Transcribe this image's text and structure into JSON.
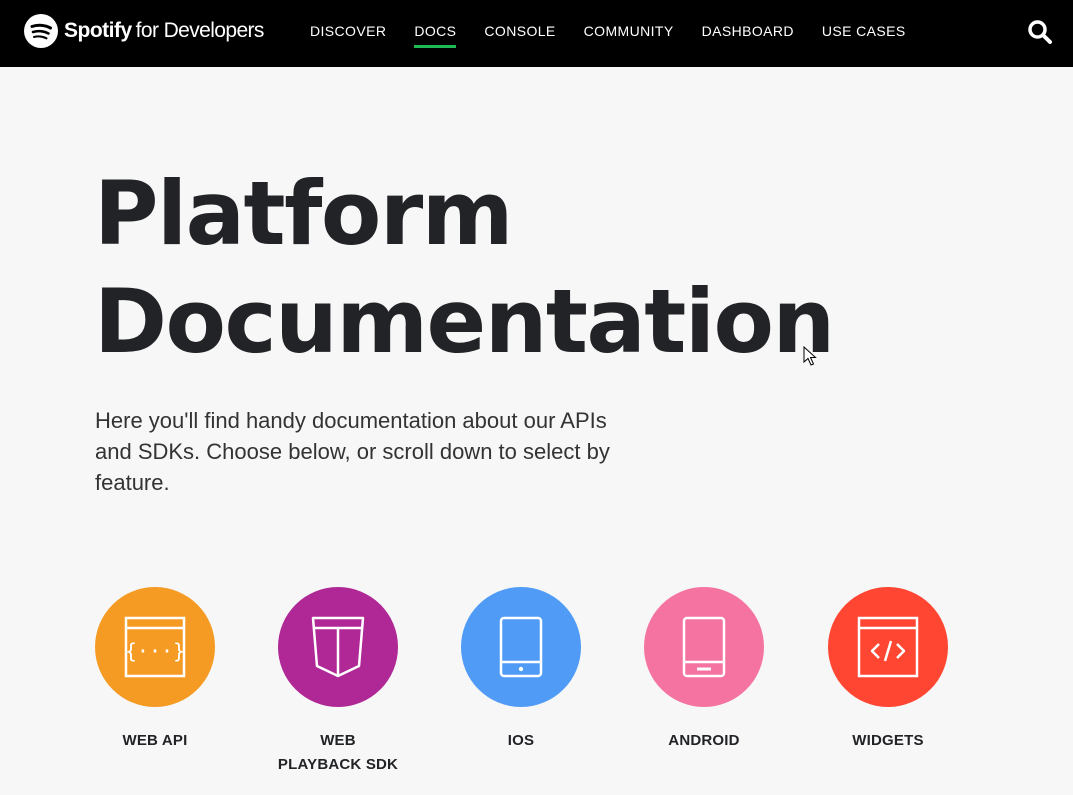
{
  "header": {
    "brand": "Spotify",
    "brand_suffix": "for Developers",
    "nav": [
      {
        "label": "DISCOVER",
        "active": false
      },
      {
        "label": "DOCS",
        "active": true
      },
      {
        "label": "CONSOLE",
        "active": false
      },
      {
        "label": "COMMUNITY",
        "active": false
      },
      {
        "label": "DASHBOARD",
        "active": false
      },
      {
        "label": "USE CASES",
        "active": false
      }
    ],
    "search_icon": "search-icon"
  },
  "hero": {
    "title_line1": "Platform",
    "title_line2": "Documentation",
    "intro": "Here you'll find handy documentation about our APIs and SDKs. Choose below, or scroll down to select by feature."
  },
  "features": [
    {
      "label": "WEB API",
      "icon": "code-window-icon",
      "color": "#f59b23"
    },
    {
      "label_line1": "WEB",
      "label_line2": "PLAYBACK SDK",
      "icon": "browser-shield-icon",
      "color": "#af2896"
    },
    {
      "label": "IOS",
      "icon": "iphone-icon",
      "color": "#509bf5"
    },
    {
      "label": "ANDROID",
      "icon": "android-phone-icon",
      "color": "#f573a0"
    },
    {
      "label": "WIDGETS",
      "icon": "code-tag-window-icon",
      "color": "#ff4632"
    }
  ],
  "colors": {
    "header_bg": "#000000",
    "active_underline": "#1db954",
    "page_bg": "#f7f7f7",
    "text": "#222326"
  }
}
